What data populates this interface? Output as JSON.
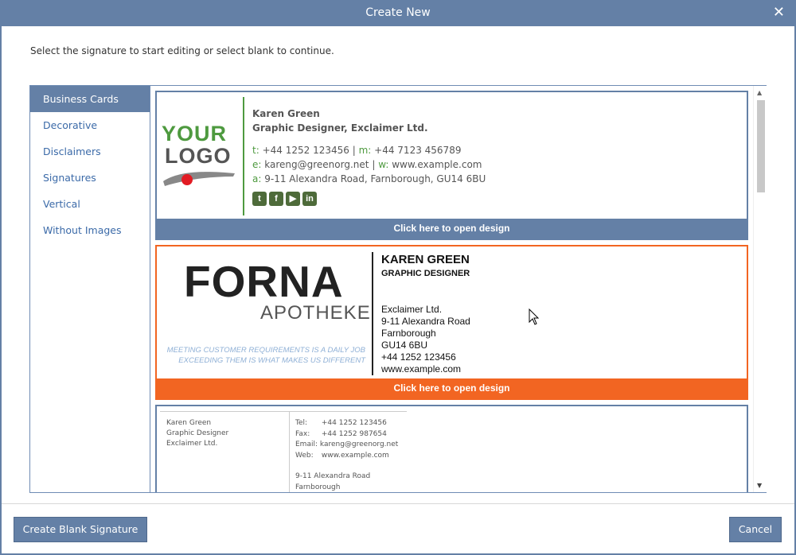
{
  "window": {
    "title": "Create New",
    "close_glyph": "✕"
  },
  "instruction": "Select the signature to start editing or select blank to continue.",
  "sidebar": {
    "items": [
      {
        "label": "Business Cards",
        "active": true
      },
      {
        "label": "Decorative"
      },
      {
        "label": "Disclaimers"
      },
      {
        "label": "Signatures"
      },
      {
        "label": "Vertical"
      },
      {
        "label": "Without Images"
      }
    ]
  },
  "card1": {
    "logo_line1": "YOUR",
    "logo_line2": "LOGO",
    "name": "Karen Green",
    "role": "Graphic Designer, Exclaimer Ltd.",
    "line_phone": {
      "t_label": "t:",
      "t_value": "+44 1252 123456",
      "sep": "|",
      "m_label": "m:",
      "m_value": "+44 7123 456789"
    },
    "line_email": {
      "e_label": "e:",
      "e_value": "kareng@greenorg.net",
      "sep": "|",
      "w_label": "w:",
      "w_value": "www.example.com"
    },
    "line_addr": {
      "a_label": "a:",
      "a_value": "9-11 Alexandra Road, Farnborough, GU14 6BU"
    },
    "social_icons": [
      "twitter-icon",
      "facebook-icon",
      "youtube-icon",
      "linkedin-icon"
    ],
    "open_label": "Click here to open design"
  },
  "card2": {
    "logo_main": "FORNA",
    "logo_sub": "APOTHEKE",
    "slogan_line1": "MEETING CUSTOMER REQUIREMENTS IS A DAILY JOB",
    "slogan_line2": "EXCEEDING THEM IS WHAT MAKES US DIFFERENT",
    "name": "KAREN GREEN",
    "role": "GRAPHIC DESIGNER",
    "address": [
      "Exclaimer Ltd.",
      "9-11 Alexandra Road",
      "Farnborough",
      "GU14 6BU",
      "+44 1252 123456",
      "www.example.com"
    ],
    "open_label": "Click here to open design"
  },
  "card3": {
    "left": [
      "Karen Green",
      "Graphic Designer",
      "Exclaimer Ltd."
    ],
    "tel_label": "Tel:",
    "tel": "+44 1252 123456",
    "fax_label": "Fax:",
    "fax": "+44 1252 987654",
    "email_label": "Email:",
    "email": "kareng@greenorg.net",
    "web_label": "Web:",
    "web": "www.example.com",
    "addr1": "9-11 Alexandra Road",
    "addr2": "Farnborough"
  },
  "buttons": {
    "blank": "Create Blank Signature",
    "cancel": "Cancel"
  },
  "colors": {
    "accent": "#6480a6",
    "orange": "#f26522",
    "green": "#4e9a3f"
  }
}
